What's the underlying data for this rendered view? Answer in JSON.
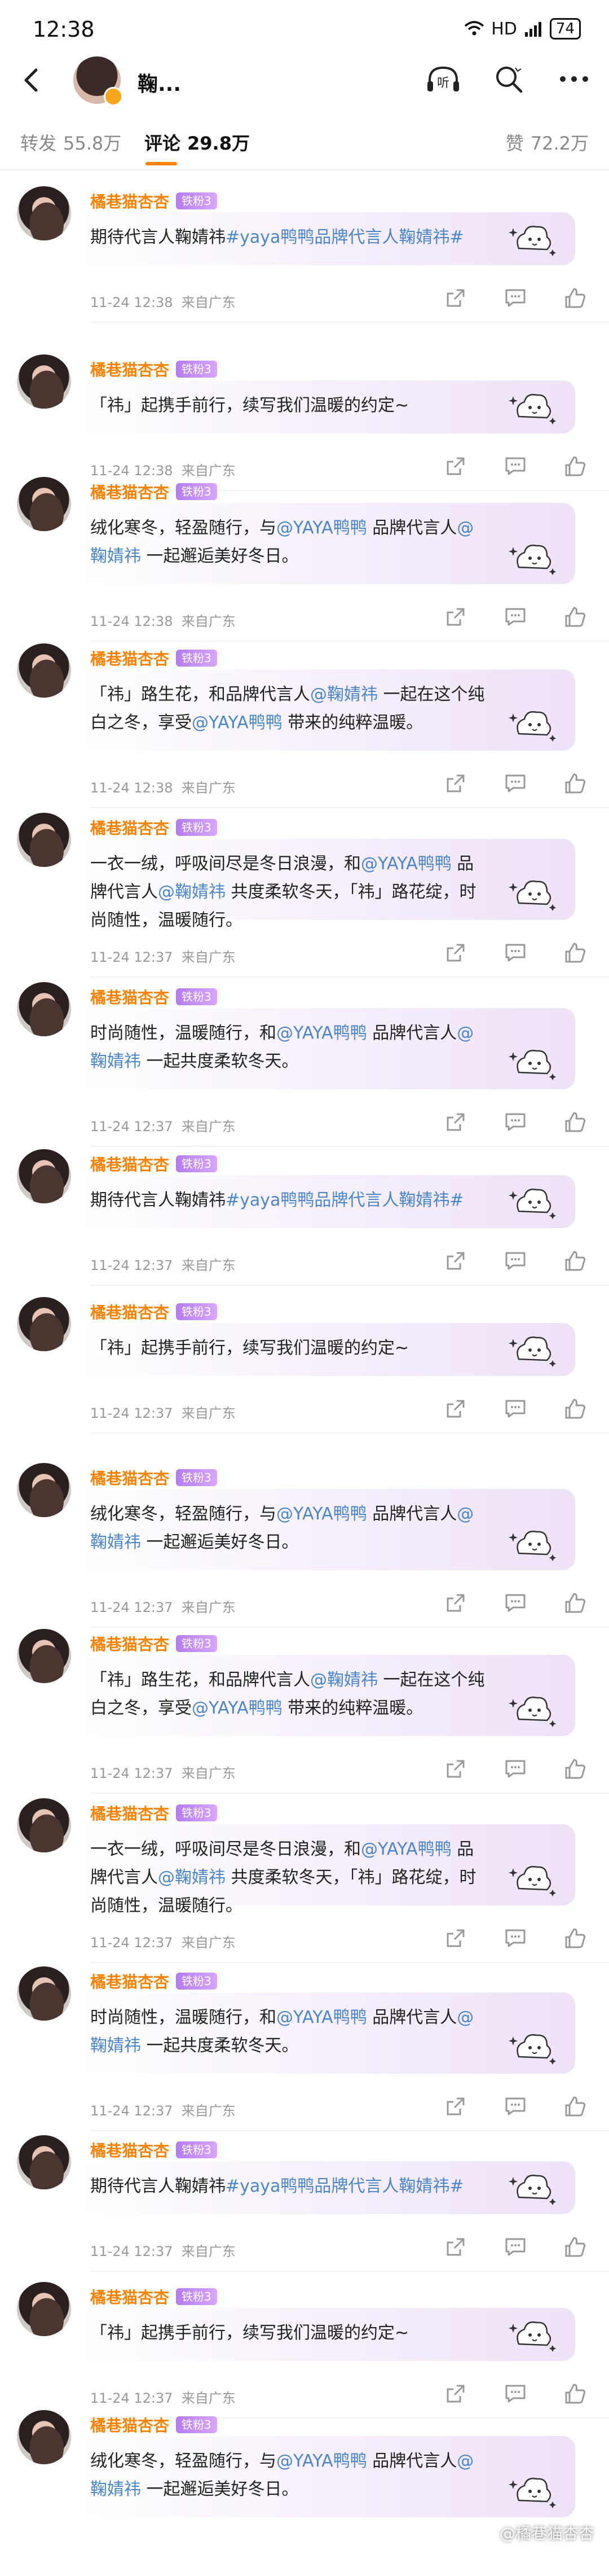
{
  "status_bar": {
    "time": "12:38",
    "signal": "HD",
    "battery": "74"
  },
  "header": {
    "name": "鞠...",
    "listen_label": "听"
  },
  "tabs": [
    {
      "label": "转发",
      "count": "55.8万"
    },
    {
      "label": "评论",
      "count": "29.8万"
    },
    {
      "label": "赞",
      "count": "72.2万"
    }
  ],
  "comments": [
    {
      "user": "橘巷猫杏杏",
      "badge": "铁粉3",
      "text_parts": [
        {
          "t": "期待代言人鞠婧祎",
          "m": false
        },
        {
          "t": "#yaya鸭鸭品牌代言人鞠婧祎#",
          "m": true
        }
      ],
      "time": "11-24  12:38",
      "location": "来自广东"
    },
    {
      "user": "橘巷猫杏杏",
      "badge": "铁粉3",
      "text_parts": [
        {
          "t": "「祎」起携手前行，续写我们温暖的约定~",
          "m": false
        }
      ],
      "time": "11-24  12:38",
      "location": "来自广东"
    },
    {
      "user": "橘巷猫杏杏",
      "badge": "铁粉3",
      "text_parts": [
        {
          "t": "绒化寒冬，轻盈随行，与",
          "m": false
        },
        {
          "t": "@YAYA鸭鸭",
          "m": true
        },
        {
          "t": " 品牌代言人",
          "m": false
        },
        {
          "t": "@鞠婧祎",
          "m": true
        },
        {
          "t": " 一起邂逅美好冬日。",
          "m": false
        }
      ],
      "time": "11-24  12:38",
      "location": "来自广东"
    },
    {
      "user": "橘巷猫杏杏",
      "badge": "铁粉3",
      "text_parts": [
        {
          "t": "「祎」路生花，和品牌代言人",
          "m": false
        },
        {
          "t": "@鞠婧祎",
          "m": true
        },
        {
          "t": " 一起在这个纯白之冬，享受",
          "m": false
        },
        {
          "t": "@YAYA鸭鸭",
          "m": true
        },
        {
          "t": " 带来的纯粹温暖。",
          "m": false
        }
      ],
      "time": "11-24  12:38",
      "location": "来自广东"
    },
    {
      "user": "橘巷猫杏杏",
      "badge": "铁粉3",
      "text_parts": [
        {
          "t": "一衣一绒，呼吸间尽是冬日浪漫，和",
          "m": false
        },
        {
          "t": "@YAYA鸭鸭",
          "m": true
        },
        {
          "t": " 品牌代言人",
          "m": false
        },
        {
          "t": "@鞠婧祎",
          "m": true
        },
        {
          "t": " 共度柔软冬天，「祎」路花绽，时尚随性，温暖随行。",
          "m": false
        }
      ],
      "time": "11-24  12:37",
      "location": "来自广东"
    },
    {
      "user": "橘巷猫杏杏",
      "badge": "铁粉3",
      "text_parts": [
        {
          "t": "时尚随性，温暖随行，和",
          "m": false
        },
        {
          "t": "@YAYA鸭鸭",
          "m": true
        },
        {
          "t": " 品牌代言人",
          "m": false
        },
        {
          "t": "@鞠婧祎",
          "m": true
        },
        {
          "t": " 一起共度柔软冬天。",
          "m": false
        }
      ],
      "time": "11-24  12:37",
      "location": "来自广东"
    },
    {
      "user": "橘巷猫杏杏",
      "badge": "铁粉3",
      "text_parts": [
        {
          "t": "期待代言人鞠婧祎",
          "m": false
        },
        {
          "t": "#yaya鸭鸭品牌代言人鞠婧祎#",
          "m": true
        }
      ],
      "time": "11-24  12:37",
      "location": "来自广东"
    },
    {
      "user": "橘巷猫杏杏",
      "badge": "铁粉3",
      "text_parts": [
        {
          "t": "「祎」起携手前行，续写我们温暖的约定~",
          "m": false
        }
      ],
      "time": "11-24  12:37",
      "location": "来自广东"
    },
    {
      "user": "橘巷猫杏杏",
      "badge": "铁粉3",
      "text_parts": [
        {
          "t": "绒化寒冬，轻盈随行，与",
          "m": false
        },
        {
          "t": "@YAYA鸭鸭",
          "m": true
        },
        {
          "t": " 品牌代言人",
          "m": false
        },
        {
          "t": "@鞠婧祎",
          "m": true
        },
        {
          "t": " 一起邂逅美好冬日。",
          "m": false
        }
      ],
      "time": "11-24  12:37",
      "location": "来自广东"
    },
    {
      "user": "橘巷猫杏杏",
      "badge": "铁粉3",
      "text_parts": [
        {
          "t": "「祎」路生花，和品牌代言人",
          "m": false
        },
        {
          "t": "@鞠婧祎",
          "m": true
        },
        {
          "t": " 一起在这个纯白之冬，享受",
          "m": false
        },
        {
          "t": "@YAYA鸭鸭",
          "m": true
        },
        {
          "t": " 带来的纯粹温暖。",
          "m": false
        }
      ],
      "time": "11-24  12:37",
      "location": "来自广东"
    },
    {
      "user": "橘巷猫杏杏",
      "badge": "铁粉3",
      "text_parts": [
        {
          "t": "一衣一绒，呼吸间尽是冬日浪漫，和",
          "m": false
        },
        {
          "t": "@YAYA鸭鸭",
          "m": true
        },
        {
          "t": " 品牌代言人",
          "m": false
        },
        {
          "t": "@鞠婧祎",
          "m": true
        },
        {
          "t": " 共度柔软冬天，「祎」路花绽，时尚随性，温暖随行。",
          "m": false
        }
      ],
      "time": "11-24  12:37",
      "location": "来自广东"
    },
    {
      "user": "橘巷猫杏杏",
      "badge": "铁粉3",
      "text_parts": [
        {
          "t": "时尚随性，温暖随行，和",
          "m": false
        },
        {
          "t": "@YAYA鸭鸭",
          "m": true
        },
        {
          "t": " 品牌代言人",
          "m": false
        },
        {
          "t": "@鞠婧祎",
          "m": true
        },
        {
          "t": " 一起共度柔软冬天。",
          "m": false
        }
      ],
      "time": "11-24  12:37",
      "location": "来自广东"
    },
    {
      "user": "橘巷猫杏杏",
      "badge": "铁粉3",
      "text_parts": [
        {
          "t": "期待代言人鞠婧祎",
          "m": false
        },
        {
          "t": "#yaya鸭鸭品牌代言人鞠婧祎#",
          "m": true
        }
      ],
      "time": "11-24  12:37",
      "location": "来自广东"
    },
    {
      "user": "橘巷猫杏杏",
      "badge": "铁粉3",
      "text_parts": [
        {
          "t": "「祎」起携手前行，续写我们温暖的约定~",
          "m": false
        }
      ],
      "time": "11-24  12:37",
      "location": "来自广东"
    },
    {
      "user": "橘巷猫杏杏",
      "badge": "铁粉3",
      "text_parts": [
        {
          "t": "绒化寒冬，轻盈随行，与",
          "m": false
        },
        {
          "t": "@YAYA鸭鸭",
          "m": true
        },
        {
          "t": " 品牌代言人",
          "m": false
        },
        {
          "t": "@鞠婧祎",
          "m": true
        },
        {
          "t": " 一起邂逅美好冬日。",
          "m": false
        }
      ],
      "time": "",
      "location": ""
    }
  ],
  "watermark": "@橘巷猫杏杏",
  "icons": {
    "back": "back-arrow-icon",
    "listen": "headphones-icon",
    "search": "search-icon",
    "more": "more-icon",
    "share": "share-icon",
    "comment": "comment-icon",
    "like": "like-icon"
  },
  "colors": {
    "username": "#ff8200",
    "mention": "#4a86c8",
    "badge": "#c08cf5",
    "tab_indicator": "#ff8200"
  }
}
